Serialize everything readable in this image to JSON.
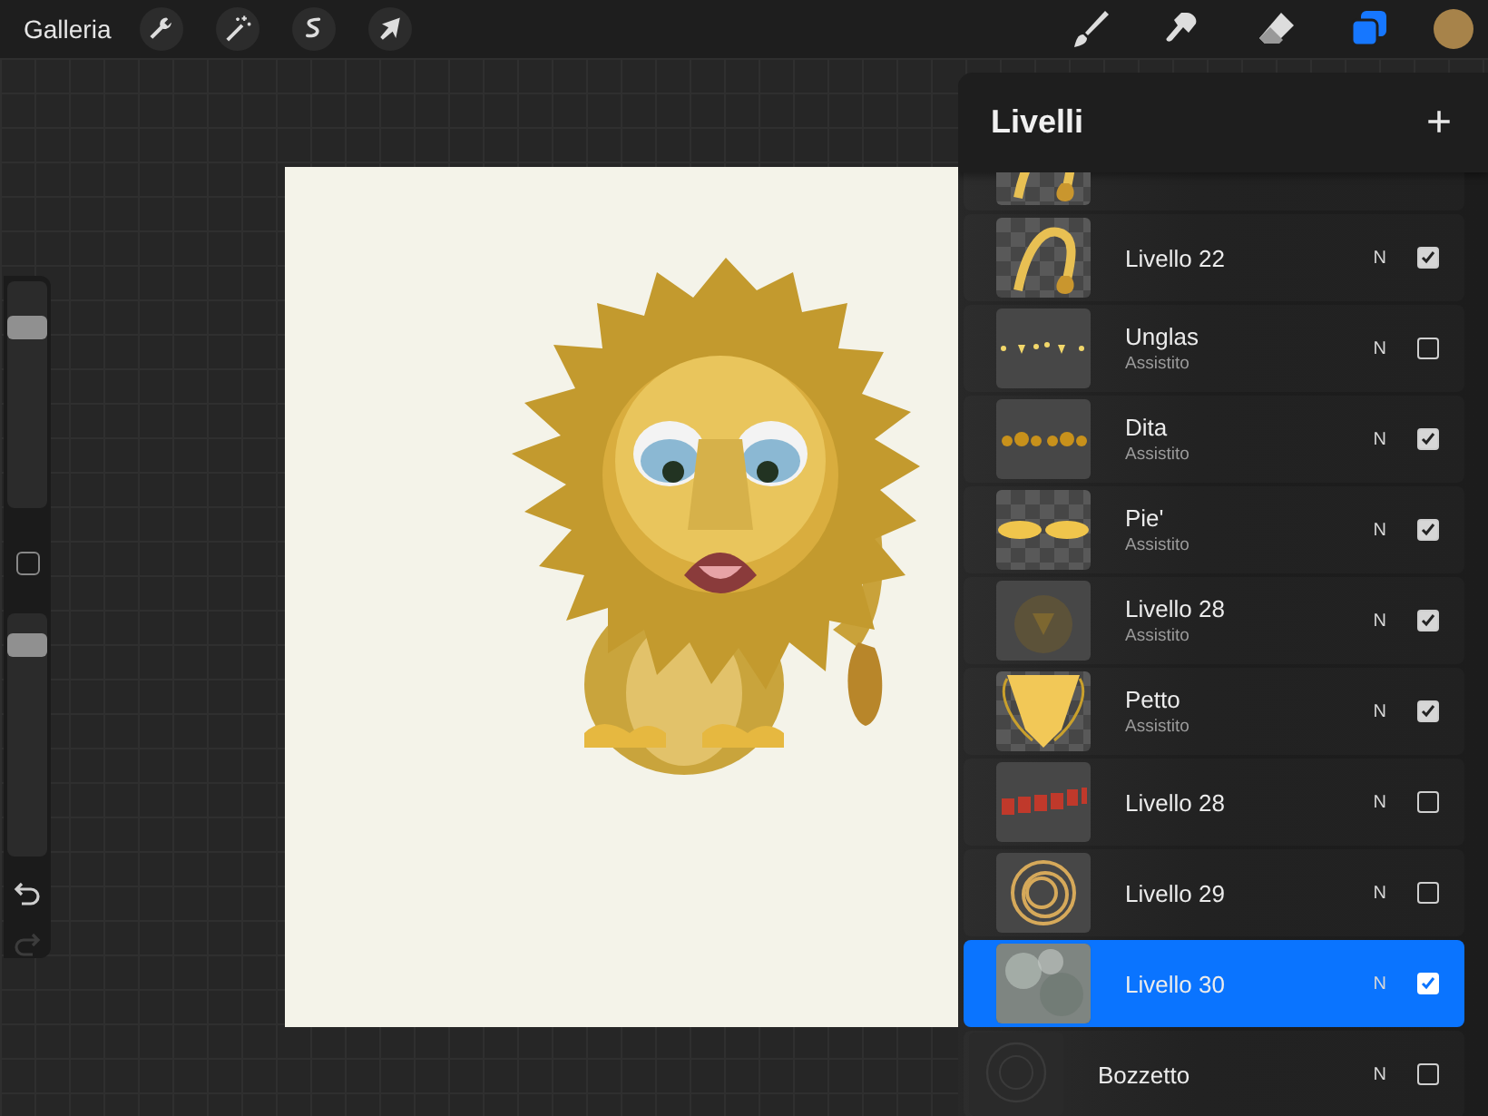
{
  "top_bar": {
    "gallery_label": "Galleria",
    "actions": [
      {
        "kind": "wrench"
      },
      {
        "kind": "wand"
      },
      {
        "kind": "selection"
      },
      {
        "kind": "arrow"
      }
    ],
    "tools": [
      {
        "kind": "brush",
        "selected": false
      },
      {
        "kind": "smudge",
        "selected": false
      },
      {
        "kind": "eraser",
        "selected": false
      },
      {
        "kind": "layers",
        "selected": true
      }
    ]
  },
  "sidebar": {
    "brush_size": {
      "level": 0.83
    },
    "opacity": {
      "level": 0.91
    },
    "undo": {
      "disabled": false
    },
    "redo": {
      "disabled": true
    }
  },
  "layers_panel": {
    "title": "Livelli",
    "add_label": "+",
    "layers": [
      {
        "kind": "partial",
        "thumbnail": {
          "kind": "tail",
          "transparent": true
        }
      },
      {
        "kind": "layer",
        "name": "Livello 22",
        "blend": "N",
        "thumbnail": {
          "kind": "tail",
          "transparent": true
        },
        "visible": true,
        "selected": false
      },
      {
        "kind": "layer",
        "name": "Unglas",
        "subtitle": "Assistito",
        "blend": "N",
        "thumbnail": {
          "kind": "claws",
          "transparent": false
        },
        "visible": false,
        "selected": false
      },
      {
        "kind": "layer",
        "name": "Dita",
        "subtitle": "Assistito",
        "blend": "N",
        "thumbnail": {
          "kind": "toes",
          "transparent": false
        },
        "visible": true,
        "selected": false
      },
      {
        "kind": "layer",
        "name": "Pie'",
        "subtitle": "Assistito",
        "blend": "N",
        "thumbnail": {
          "kind": "feet",
          "transparent": true
        },
        "visible": true,
        "selected": false
      },
      {
        "kind": "layer",
        "name": "Livello 28",
        "subtitle": "Assistito",
        "blend": "N",
        "thumbnail": {
          "kind": "mane",
          "transparent": false
        },
        "visible": true,
        "selected": false
      },
      {
        "kind": "layer",
        "name": "Petto",
        "subtitle": "Assistito",
        "blend": "N",
        "thumbnail": {
          "kind": "chest",
          "transparent": true
        },
        "visible": true,
        "selected": false
      },
      {
        "kind": "layer",
        "name": "Livello 28",
        "blend": "N",
        "thumbnail": {
          "kind": "roar",
          "transparent": false
        },
        "visible": false,
        "selected": false
      },
      {
        "kind": "layer",
        "name": "Livello 29",
        "blend": "N",
        "thumbnail": {
          "kind": "rings",
          "transparent": false
        },
        "visible": false,
        "selected": false
      },
      {
        "kind": "layer",
        "name": "Livello 30",
        "blend": "N",
        "thumbnail": {
          "kind": "texture"
        },
        "visible": true,
        "selected": true
      },
      {
        "kind": "background",
        "name": "Bozzetto",
        "blend": "N",
        "thumbnail": {
          "kind": "sketch",
          "transparent": false
        },
        "visible": false,
        "selected": false
      }
    ]
  }
}
